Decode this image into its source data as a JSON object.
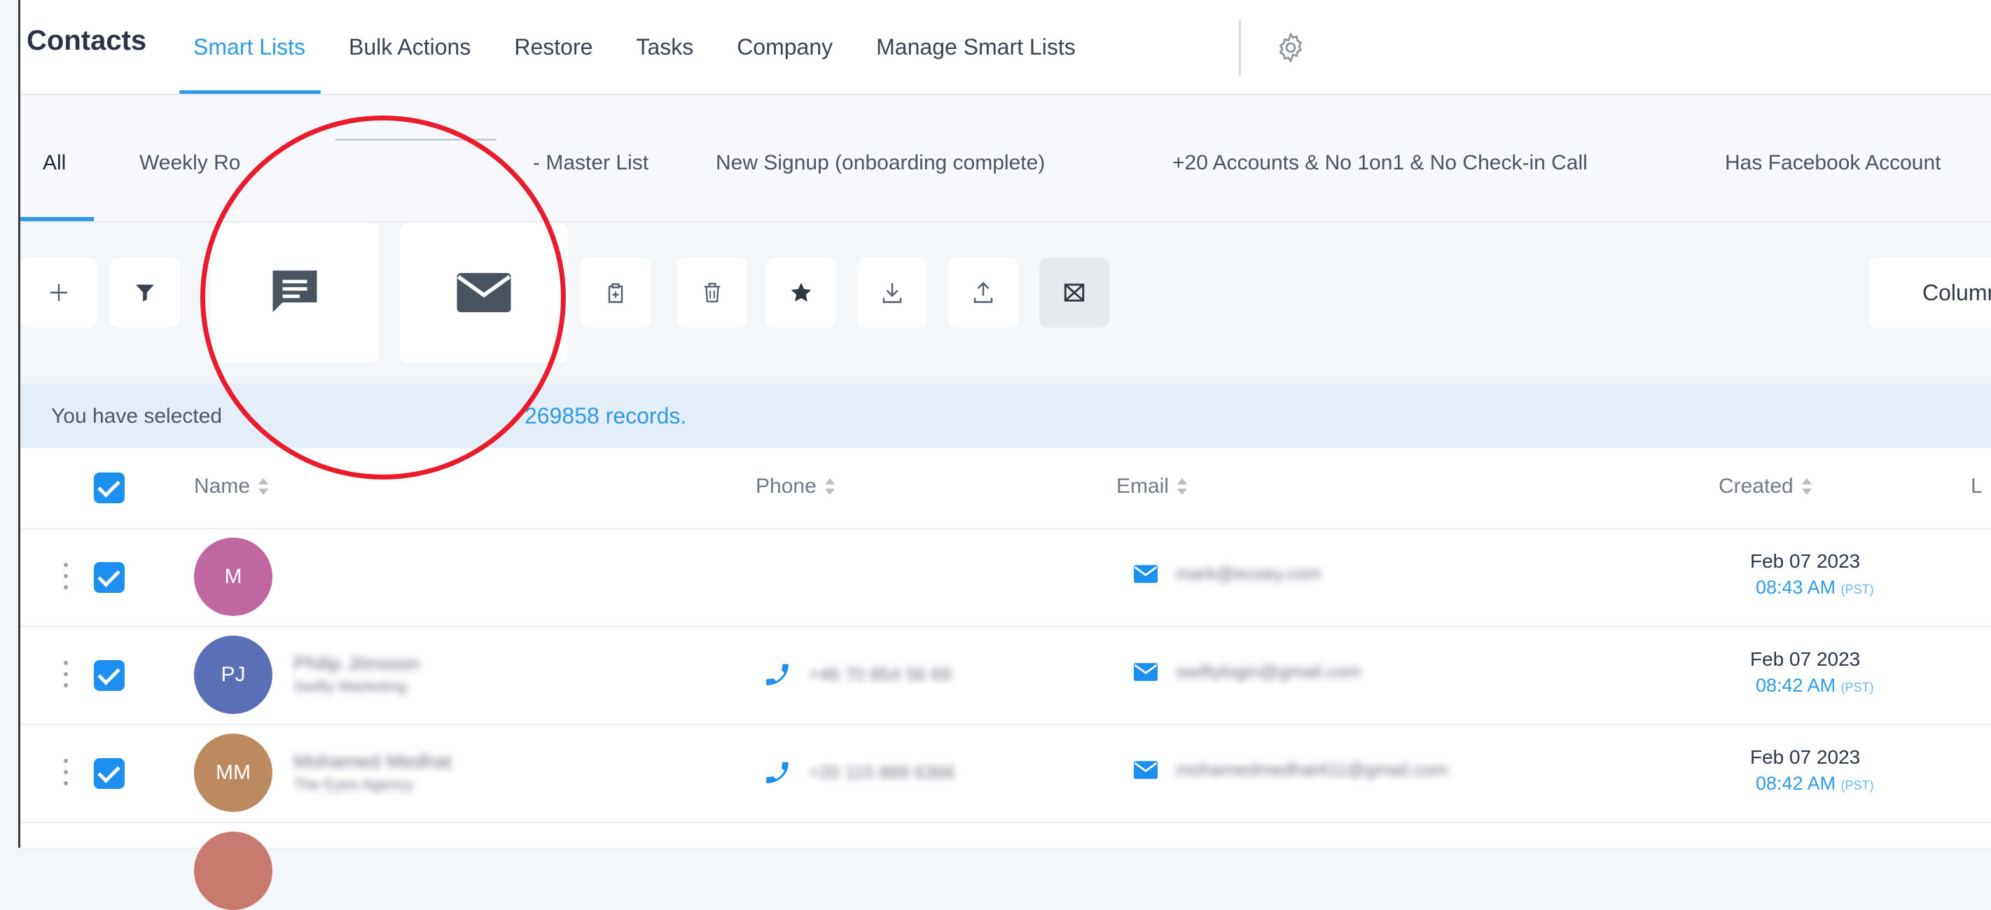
{
  "header": {
    "title": "Contacts",
    "tabs": [
      {
        "label": "Smart Lists",
        "active": true
      },
      {
        "label": "Bulk Actions"
      },
      {
        "label": "Restore"
      },
      {
        "label": "Tasks"
      },
      {
        "label": "Company"
      },
      {
        "label": "Manage Smart Lists"
      }
    ],
    "settings_icon": "gear-icon"
  },
  "smart_lists": [
    {
      "label": "All",
      "active": true
    },
    {
      "label": "Weekly Ro"
    },
    {
      "label": "- Master List"
    },
    {
      "label": "New Signup (onboarding complete)"
    },
    {
      "label": "+20 Accounts & No 1on1 & No Check-in Call"
    },
    {
      "label": "Has Facebook Account"
    }
  ],
  "toolbar": {
    "buttons": [
      "plus-icon",
      "filter-icon",
      "message-icon",
      "email-icon",
      "clipboard-icon",
      "trash-icon",
      "star-icon",
      "download-icon",
      "upload-icon",
      "merge-icon"
    ],
    "columns_label": "Column"
  },
  "selection": {
    "prefix": "You have selected",
    "records": "269858 records."
  },
  "table": {
    "headers": [
      "Name",
      "Phone",
      "Email",
      "Created",
      "L"
    ],
    "rows": [
      {
        "initials": "M",
        "avatar_color": "#c0679f",
        "name": "",
        "company": "",
        "phone": "",
        "email": "mark@ecoey.com",
        "created_date": "Feb 07 2023",
        "created_time": "08:43 AM",
        "tz": "(PST)"
      },
      {
        "initials": "PJ",
        "avatar_color": "#5b6fb6",
        "name": "Philip Jönsson",
        "company": "Swifty Marketing",
        "phone": "+46 70 854 56 69",
        "email": "swiftylogin@gmail.com",
        "created_date": "Feb 07 2023",
        "created_time": "08:42 AM",
        "tz": "(PST)"
      },
      {
        "initials": "MM",
        "avatar_color": "#bd8a5f",
        "name": "Mohamed Medhat",
        "company": "The Eyes Agency",
        "phone": "+20 115 889 6366",
        "email": "mohamedmedhat411@gmail.com",
        "created_date": "Feb 07 2023",
        "created_time": "08:42 AM",
        "tz": "(PST)"
      }
    ]
  },
  "colors": {
    "accent": "#2e9bea",
    "checkbox": "#1d8ff0",
    "annotation": "#ea1c2c"
  }
}
